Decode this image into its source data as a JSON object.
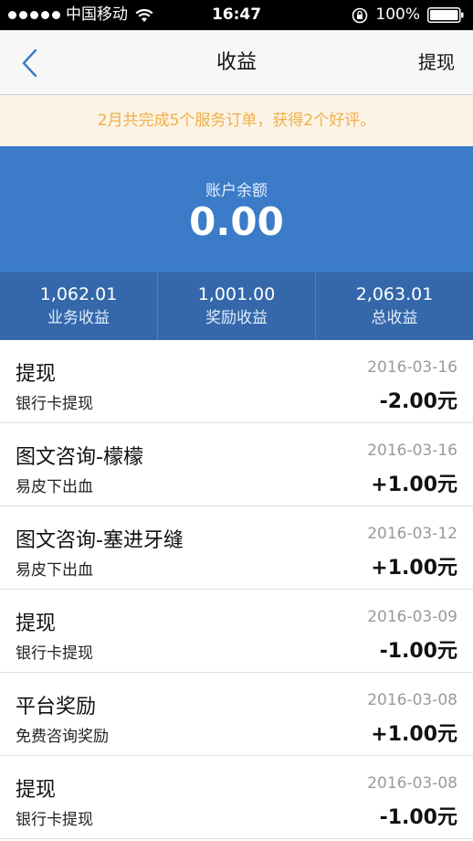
{
  "status_bar": {
    "carrier": "中国移动",
    "time": "16:47",
    "battery": "100%"
  },
  "nav": {
    "title": "收益",
    "action": "提现"
  },
  "notice": "2月共完成5个服务订单，获得2个好评。",
  "balance": {
    "label": "账户余额",
    "value": "0.00"
  },
  "stats": [
    {
      "value": "1,062.01",
      "label": "业务收益"
    },
    {
      "value": "1,001.00",
      "label": "奖励收益"
    },
    {
      "value": "2,063.01",
      "label": "总收益"
    }
  ],
  "transactions": [
    {
      "title": "提现",
      "subtitle": "银行卡提现",
      "date": "2016-03-16",
      "amount": "-2.00元"
    },
    {
      "title": "图文咨询-檬檬",
      "subtitle": "易皮下出血",
      "date": "2016-03-16",
      "amount": "+1.00元"
    },
    {
      "title": "图文咨询-塞进牙缝",
      "subtitle": "易皮下出血",
      "date": "2016-03-12",
      "amount": "+1.00元"
    },
    {
      "title": "提现",
      "subtitle": "银行卡提现",
      "date": "2016-03-09",
      "amount": "-1.00元"
    },
    {
      "title": "平台奖励",
      "subtitle": "免费咨询奖励",
      "date": "2016-03-08",
      "amount": "+1.00元"
    },
    {
      "title": "提现",
      "subtitle": "银行卡提现",
      "date": "2016-03-08",
      "amount": "-1.00元"
    }
  ],
  "colors": {
    "nav_background": "#f7f7f7",
    "notice_background": "#fbf3e6",
    "notice_text": "#f0b046",
    "balance_background": "#3b7bc7",
    "stats_background": "#3468ab",
    "back_arrow": "#3b7bc7"
  },
  "icons": {
    "back": "chevron-left-icon",
    "wifi": "wifi-icon",
    "orientation_lock": "lock-rotation-icon",
    "battery": "battery-icon"
  }
}
